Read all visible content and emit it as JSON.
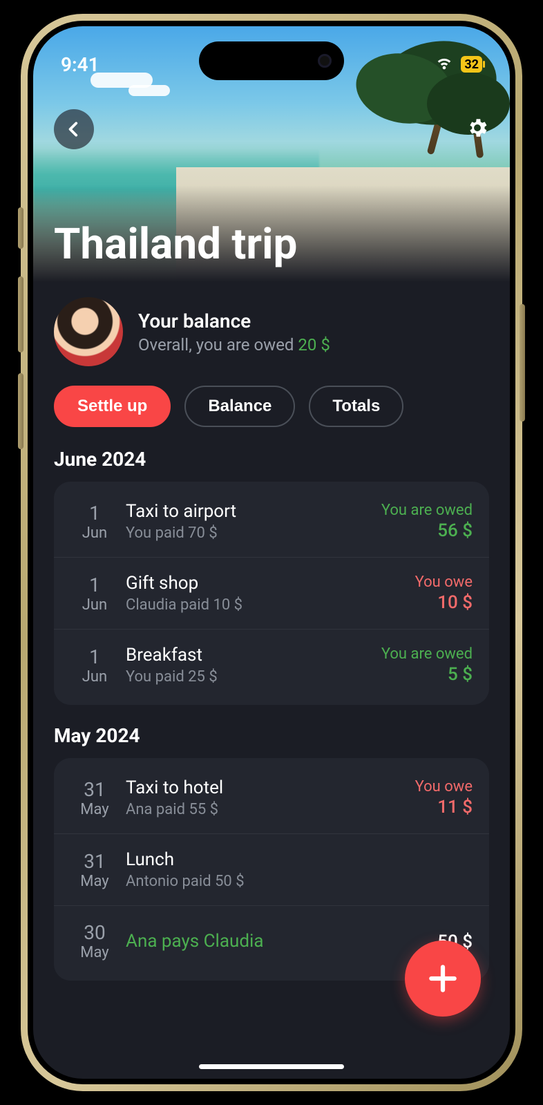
{
  "status": {
    "time": "9:41",
    "battery": "32"
  },
  "trip": {
    "title": "Thailand trip"
  },
  "balance": {
    "label": "Your balance",
    "subtext": "Overall, you are owed ",
    "amount": "20 $"
  },
  "actions": {
    "settle": "Settle up",
    "balance": "Balance",
    "totals": "Totals"
  },
  "sections": [
    {
      "heading": "June 2024",
      "items": [
        {
          "day": "1",
          "mon": "Jun",
          "title": "Taxi to airport",
          "sub": "You paid 70 $",
          "status": "You are owed",
          "amt": "56 $",
          "cls": "owed"
        },
        {
          "day": "1",
          "mon": "Jun",
          "title": "Gift shop",
          "sub": "Claudia paid 10 $",
          "status": "You owe",
          "amt": "10 $",
          "cls": "owe"
        },
        {
          "day": "1",
          "mon": "Jun",
          "title": "Breakfast",
          "sub": "You paid 25 $",
          "status": "You are owed",
          "amt": "5 $",
          "cls": "owed"
        }
      ]
    },
    {
      "heading": "May 2024",
      "items": [
        {
          "day": "31",
          "mon": "May",
          "title": "Taxi to hotel",
          "sub": "Ana paid 55 $",
          "status": "You owe",
          "amt": "11 $",
          "cls": "owe"
        },
        {
          "day": "31",
          "mon": "May",
          "title": "Lunch",
          "sub": "Antonio paid 50 $",
          "status": "",
          "amt": "",
          "cls": ""
        },
        {
          "day": "30",
          "mon": "May",
          "title": "Ana pays Claudia",
          "sub": "",
          "status": "",
          "amt": "50 $",
          "cls": "settlement"
        }
      ]
    }
  ]
}
